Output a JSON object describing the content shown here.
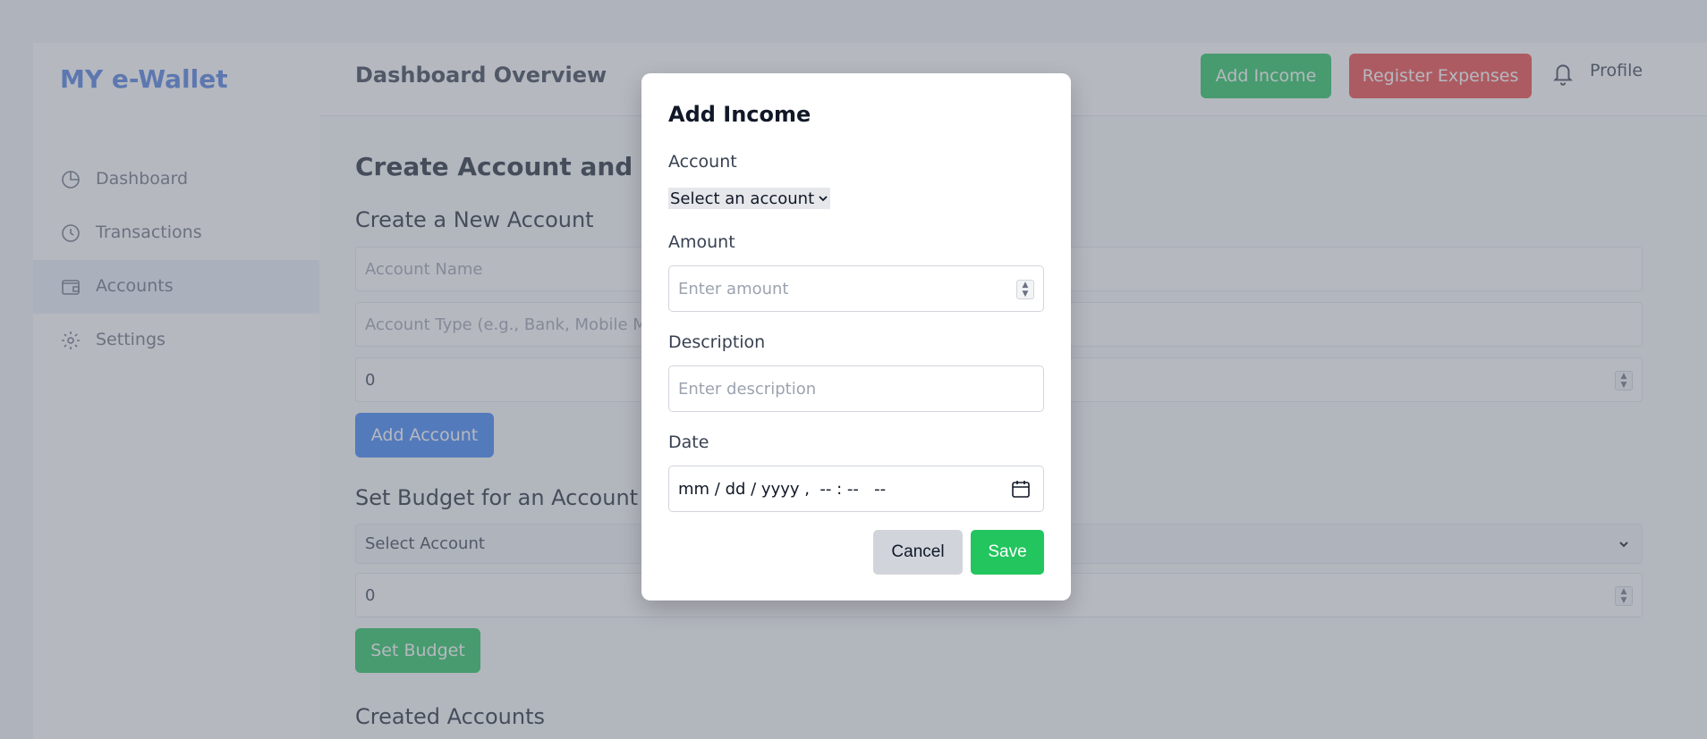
{
  "app": {
    "logo": "MY e-Wallet"
  },
  "sidebar": {
    "items": [
      {
        "label": "Dashboard",
        "icon": "pie-chart-icon"
      },
      {
        "label": "Transactions",
        "icon": "clock-icon"
      },
      {
        "label": "Accounts",
        "icon": "wallet-icon",
        "active": true
      },
      {
        "label": "Settings",
        "icon": "gear-icon"
      }
    ]
  },
  "header": {
    "title": "Dashboard Overview",
    "add_income_label": "Add Income",
    "register_expenses_label": "Register Expenses",
    "profile_label": "Profile"
  },
  "main": {
    "page_heading": "Create Account and Se",
    "create_section_title": "Create a New Account",
    "account_name_placeholder": "Account Name",
    "account_type_placeholder": "Account Type (e.g., Bank, Mobile M",
    "initial_balance_value": "0",
    "add_account_label": "Add Account",
    "budget_section_title": "Set Budget for an Account",
    "select_account_value": "Select Account",
    "budget_value": "0",
    "set_budget_label": "Set Budget",
    "created_accounts_title": "Created Accounts"
  },
  "modal": {
    "title": "Add Income",
    "account_label": "Account",
    "account_select_value": "Select an account",
    "amount_label": "Amount",
    "amount_placeholder": "Enter amount",
    "description_label": "Description",
    "description_placeholder": "Enter description",
    "date_label": "Date",
    "date_value": "mm / dd / yyyy ,  -- : --   --",
    "cancel_label": "Cancel",
    "save_label": "Save"
  },
  "colors": {
    "brand": "#4f7fe0",
    "income_green": "#22c55e",
    "expense_red": "#ef4444",
    "primary_blue": "#3b82f6"
  }
}
